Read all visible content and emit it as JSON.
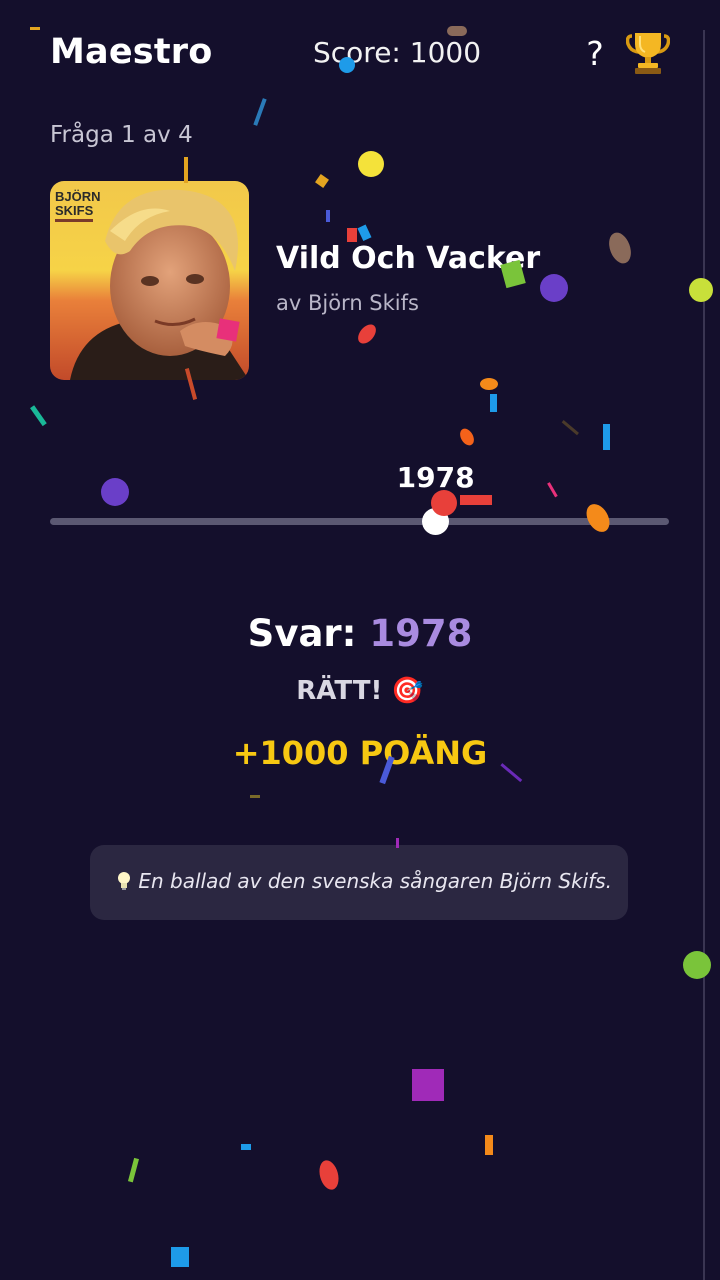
{
  "header": {
    "app_title": "Maestro",
    "score_label": "Score: 1000",
    "help_label": "?",
    "trophy_icon": "trophy-icon"
  },
  "question": {
    "counter": "Fråga 1 av 4",
    "song_title": "Vild Och Vacker",
    "artist_line": "av Björn Skifs",
    "album_cover_text": [
      "BJÖRN",
      "SKIFS"
    ]
  },
  "slider": {
    "value": "1978",
    "fraction": 0.623
  },
  "result": {
    "answer_prefix": "Svar:",
    "answer_value": "1978",
    "verdict": "RÄTT! 🎯",
    "points": "+1000 POÄNG"
  },
  "hint": {
    "icon": "lightbulb-icon",
    "text": "En ballad av den svenska sångaren Björn Skifs."
  },
  "colors": {
    "background": "#140f2c",
    "accent_purple": "#a98be0",
    "points_yellow": "#f7c812",
    "card": "#2b2741"
  }
}
